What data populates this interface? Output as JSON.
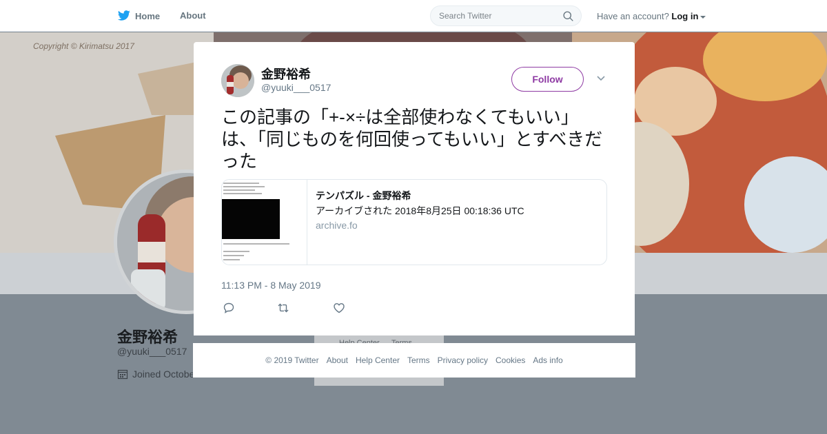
{
  "topbar": {
    "home_label": "Home",
    "about_label": "About",
    "search_placeholder": "Search Twitter",
    "account_prompt": "Have an account?",
    "login_label": "Log in"
  },
  "banner": {
    "copyright": "Copyright © Kirimatsu 2017"
  },
  "profile": {
    "name": "金野裕希",
    "handle": "@yuuki___0517",
    "joined": "Joined October",
    "side_links": [
      "Help Center",
      "Terms"
    ]
  },
  "tweet": {
    "author_name": "金野裕希",
    "author_handle": "@yuuki___0517",
    "follow_label": "Follow",
    "text": "この記事の「+-×÷は全部使わなくてもいい」は、「同じものを何回使ってもいい」とすべきだった",
    "card": {
      "title": "テンパズル - 金野裕希",
      "description": "アーカイブされた 2018年8月25日 00:18:36 UTC",
      "domain": "archive.fo"
    },
    "timestamp": "11:13 PM - 8 May 2019"
  },
  "footer": {
    "links": [
      "© 2019 Twitter",
      "About",
      "Help Center",
      "Terms",
      "Privacy policy",
      "Cookies",
      "Ads info"
    ]
  },
  "colors": {
    "follow_accent": "#8e3aa3",
    "twitter_blue": "#1da1f2",
    "overlay": "#808a93"
  }
}
